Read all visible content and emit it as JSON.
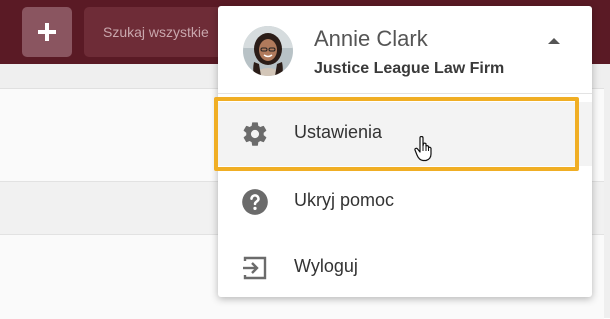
{
  "topbar": {
    "add_label": "+",
    "search_placeholder": "Szukaj wszystkie"
  },
  "user_menu": {
    "name": "Annie Clark",
    "firm": "Justice League Law Firm",
    "items": [
      {
        "label": "Ustawienia",
        "icon": "gear-icon"
      },
      {
        "label": "Ukryj pomoc",
        "icon": "help-circle-icon"
      },
      {
        "label": "Wyloguj",
        "icon": "logout-icon"
      }
    ]
  },
  "colors": {
    "topbar": "#5a1a25",
    "highlight": "#f0ae24",
    "icon": "#6b6b6b"
  }
}
